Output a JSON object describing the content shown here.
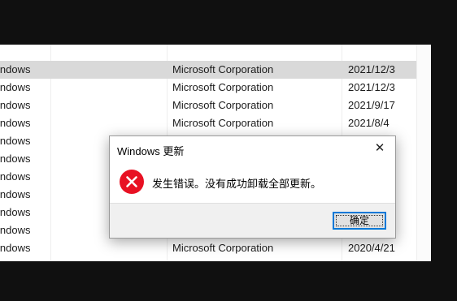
{
  "list": {
    "rows": [
      {
        "name": "indows",
        "publisher": "Microsoft Corporation",
        "date": "2021/12/3",
        "selected": true
      },
      {
        "name": "indows",
        "publisher": "Microsoft Corporation",
        "date": "2021/12/3"
      },
      {
        "name": "indows",
        "publisher": "Microsoft Corporation",
        "date": "2021/9/17"
      },
      {
        "name": "indows",
        "publisher": "Microsoft Corporation",
        "date": "2021/8/4"
      },
      {
        "name": "indows",
        "publisher": "",
        "date": ""
      },
      {
        "name": "indows",
        "publisher": "",
        "date": ""
      },
      {
        "name": "indows",
        "publisher": "",
        "date": ""
      },
      {
        "name": "indows",
        "publisher": "",
        "date": ""
      },
      {
        "name": "indows",
        "publisher": "",
        "date": ""
      },
      {
        "name": "indows",
        "publisher": "",
        "date": ""
      },
      {
        "name": "indows",
        "publisher": "Microsoft Corporation",
        "date": "2020/4/21"
      }
    ]
  },
  "dialog": {
    "title": "Windows 更新",
    "close_glyph": "✕",
    "icon": "error-icon",
    "message": "发生错误。没有成功卸载全部更新。",
    "ok_label": "确定"
  },
  "colors": {
    "error_red": "#e81123",
    "focus_blue": "#0078d7",
    "selection": "#d9d9d9"
  }
}
